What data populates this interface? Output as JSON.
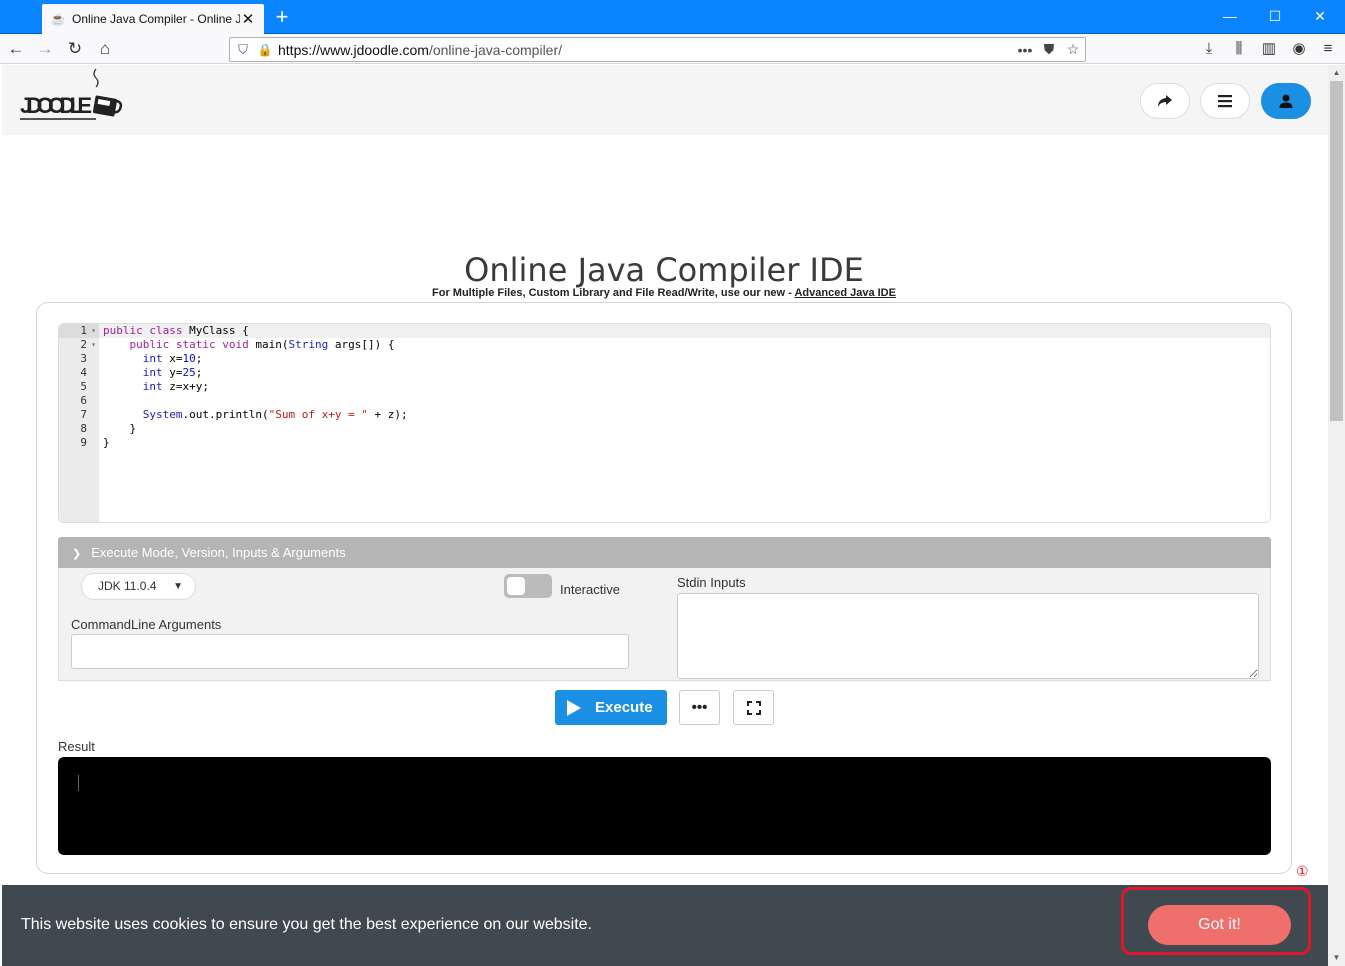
{
  "browser": {
    "tab_title": "Online Java Compiler - Online J",
    "url_host": "https://www.jdoodle.com",
    "url_path": "/online-java-compiler/"
  },
  "header": {
    "logo_text": "JDOODLE"
  },
  "page": {
    "title": "Online Java Compiler IDE",
    "subtitle_prefix": "For Multiple Files, Custom Library and File Read/Write, use our new - ",
    "subtitle_link": "Advanced Java IDE"
  },
  "editor": {
    "line_numbers": [
      "1",
      "2",
      "3",
      "4",
      "5",
      "6",
      "7",
      "8",
      "9"
    ],
    "active_line": 1
  },
  "options": {
    "header_label": "Execute Mode, Version, Inputs & Arguments",
    "jdk_selected": "JDK 11.0.4",
    "interactive_label": "Interactive",
    "interactive_on": false,
    "stdin_label": "Stdin Inputs",
    "args_label": "CommandLine Arguments"
  },
  "actions": {
    "execute_label": "Execute",
    "more_label": "•••"
  },
  "result": {
    "label": "Result"
  },
  "cookie": {
    "message": "This website uses cookies to ensure you get the best experience on our website.",
    "accept_label": "Got it!"
  },
  "annotation": {
    "marker": "①",
    "color": "#e0162b"
  },
  "colors": {
    "accent": "#1a8fe3",
    "cookie_bg": "#414950",
    "cookie_button": "#ef6f6c"
  }
}
